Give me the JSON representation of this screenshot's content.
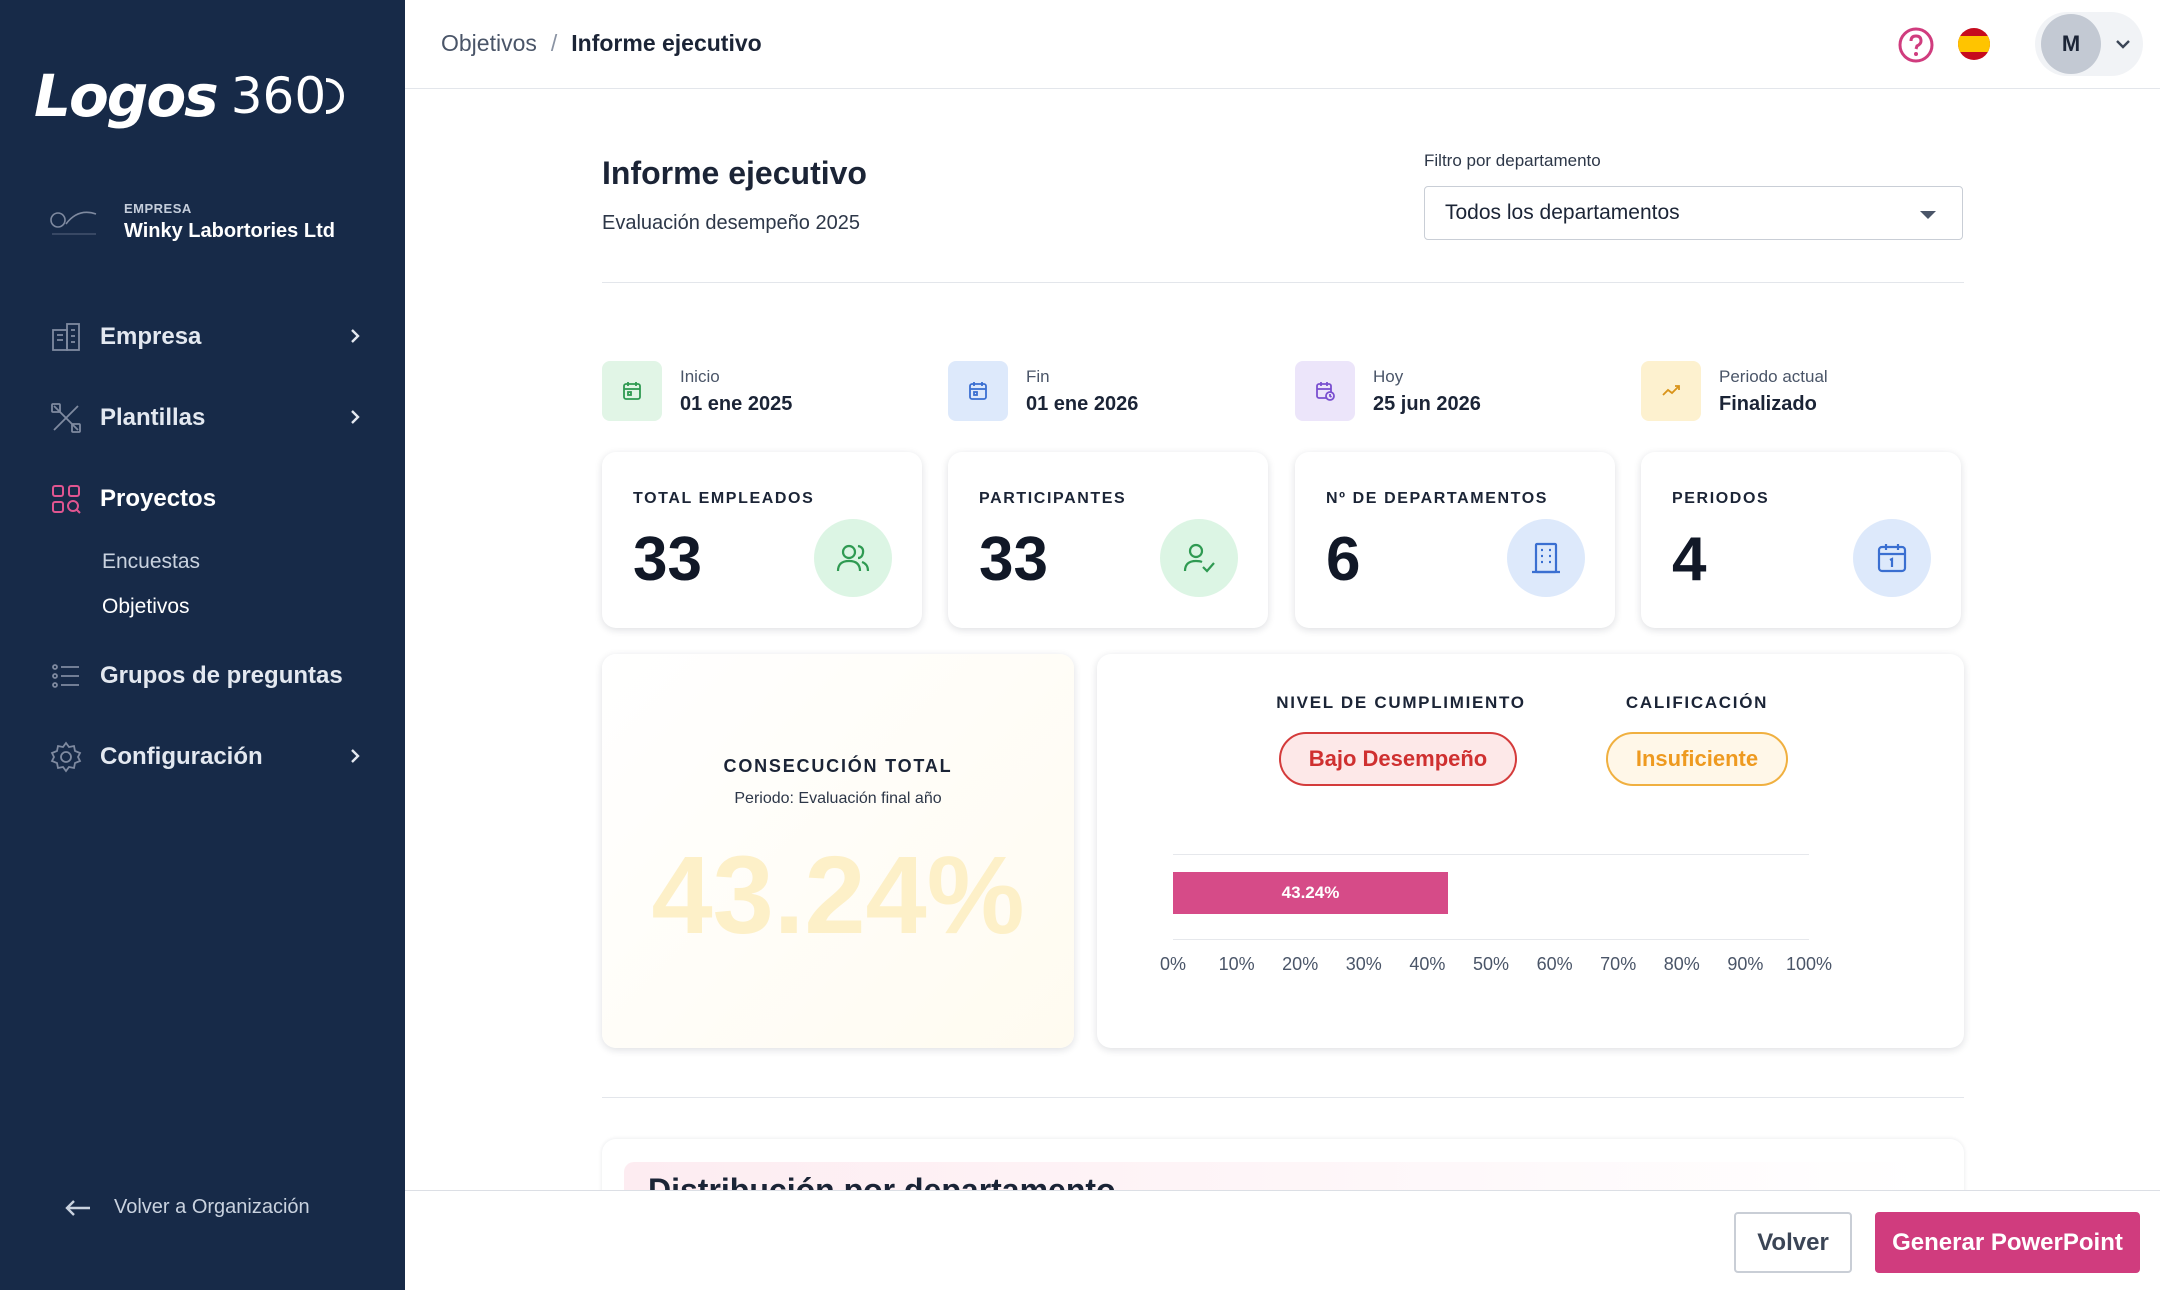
{
  "brand": {
    "logo_text": "Logos",
    "logo_number": "360"
  },
  "company": {
    "label": "EMPRESA",
    "name": "Winky Labortories Ltd"
  },
  "sidebar": {
    "items": [
      {
        "label": "Empresa"
      },
      {
        "label": "Plantillas"
      },
      {
        "label": "Proyectos"
      },
      {
        "label": "Grupos de preguntas"
      },
      {
        "label": "Configuración"
      }
    ],
    "subitems": [
      {
        "label": "Encuestas"
      },
      {
        "label": "Objetivos"
      }
    ],
    "back_label": "Volver a Organización"
  },
  "breadcrumb": {
    "parent": "Objetivos",
    "separator": "/",
    "current": "Informe ejecutivo"
  },
  "user": {
    "initial": "M"
  },
  "header": {
    "title": "Informe ejecutivo",
    "subtitle": "Evaluación desempeño 2025"
  },
  "filter": {
    "label": "Filtro por departamento",
    "value": "Todos los departamentos"
  },
  "meta": {
    "start": {
      "label": "Inicio",
      "value": "01 ene 2025"
    },
    "end": {
      "label": "Fin",
      "value": "01 ene 2026"
    },
    "today": {
      "label": "Hoy",
      "value": "25 jun 2026"
    },
    "period": {
      "label": "Periodo actual",
      "value": "Finalizado"
    }
  },
  "stats": {
    "employees": {
      "label": "TOTAL EMPLEADOS",
      "value": "33"
    },
    "participants": {
      "label": "PARTICIPANTES",
      "value": "33"
    },
    "departments": {
      "label": "Nº DE DEPARTAMENTOS",
      "value": "6"
    },
    "periods": {
      "label": "PERIODOS",
      "value": "4"
    }
  },
  "achievement": {
    "label": "CONSECUCIÓN TOTAL",
    "period": "Periodo: Evaluación final año",
    "value": "43.24%"
  },
  "level": {
    "compliance_label": "NIVEL DE CUMPLIMIENTO",
    "compliance_value": "Bajo Desempeño",
    "grade_label": "CALIFICACIÓN",
    "grade_value": "Insuficiente"
  },
  "chart_data": {
    "type": "bar",
    "orientation": "horizontal",
    "categories": [
      ""
    ],
    "values": [
      43.24
    ],
    "data_labels": [
      "43.24%"
    ],
    "xlim": [
      0,
      100
    ],
    "ticks": [
      "0%",
      "10%",
      "20%",
      "30%",
      "40%",
      "50%",
      "60%",
      "70%",
      "80%",
      "90%",
      "100%"
    ],
    "color": "#d64b88"
  },
  "distribution": {
    "title": "Distribución por departamento"
  },
  "footer": {
    "back_label": "Volver",
    "generate_label": "Generar PowerPoint"
  },
  "colors": {
    "sidebar_bg": "#172a48",
    "accent": "#d03c7e",
    "bad": "#d43b3b",
    "warning": "#f0a030"
  }
}
